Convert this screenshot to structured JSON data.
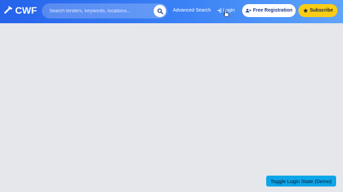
{
  "header": {
    "logo_text": "CWF",
    "logo_icon": "hammer-icon",
    "search": {
      "placeholder": "Search tenders, keywords, locations...",
      "value": "",
      "button_icon": "search-icon"
    },
    "advanced_search_label": "Advanced Search",
    "login_label": "Login",
    "login_icon": "sign-in-icon",
    "register_label": "Free Registration",
    "register_icon": "user-plus-icon",
    "subscribe_label": "Subscribe",
    "subscribe_icon": "star-icon"
  },
  "demo": {
    "toggle_label": "Toggle Login State (Demo)"
  },
  "colors": {
    "header_start": "#2563eb",
    "header_end": "#60a5fa",
    "subscribe": "#facc15",
    "toggle": "#0ea5e9",
    "background": "#e5e7eb"
  }
}
